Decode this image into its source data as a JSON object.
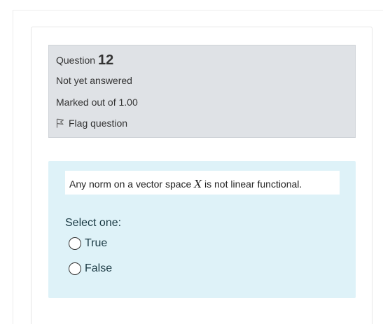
{
  "question": {
    "label": "Question",
    "number": "12",
    "state": "Not yet answered",
    "grade": "Marked out of 1.00",
    "flag_label": "Flag question"
  },
  "content": {
    "text_before": "Any norm on a vector space",
    "variable": "X",
    "text_after": "is not linear functional.",
    "prompt": "Select one:",
    "options": [
      {
        "label": "True",
        "selected": false
      },
      {
        "label": "False",
        "selected": false
      }
    ]
  },
  "colors": {
    "info_bg": "#dfe2e6",
    "content_bg": "#def2f8"
  },
  "icons": {
    "flag": "flag-outline-icon"
  }
}
